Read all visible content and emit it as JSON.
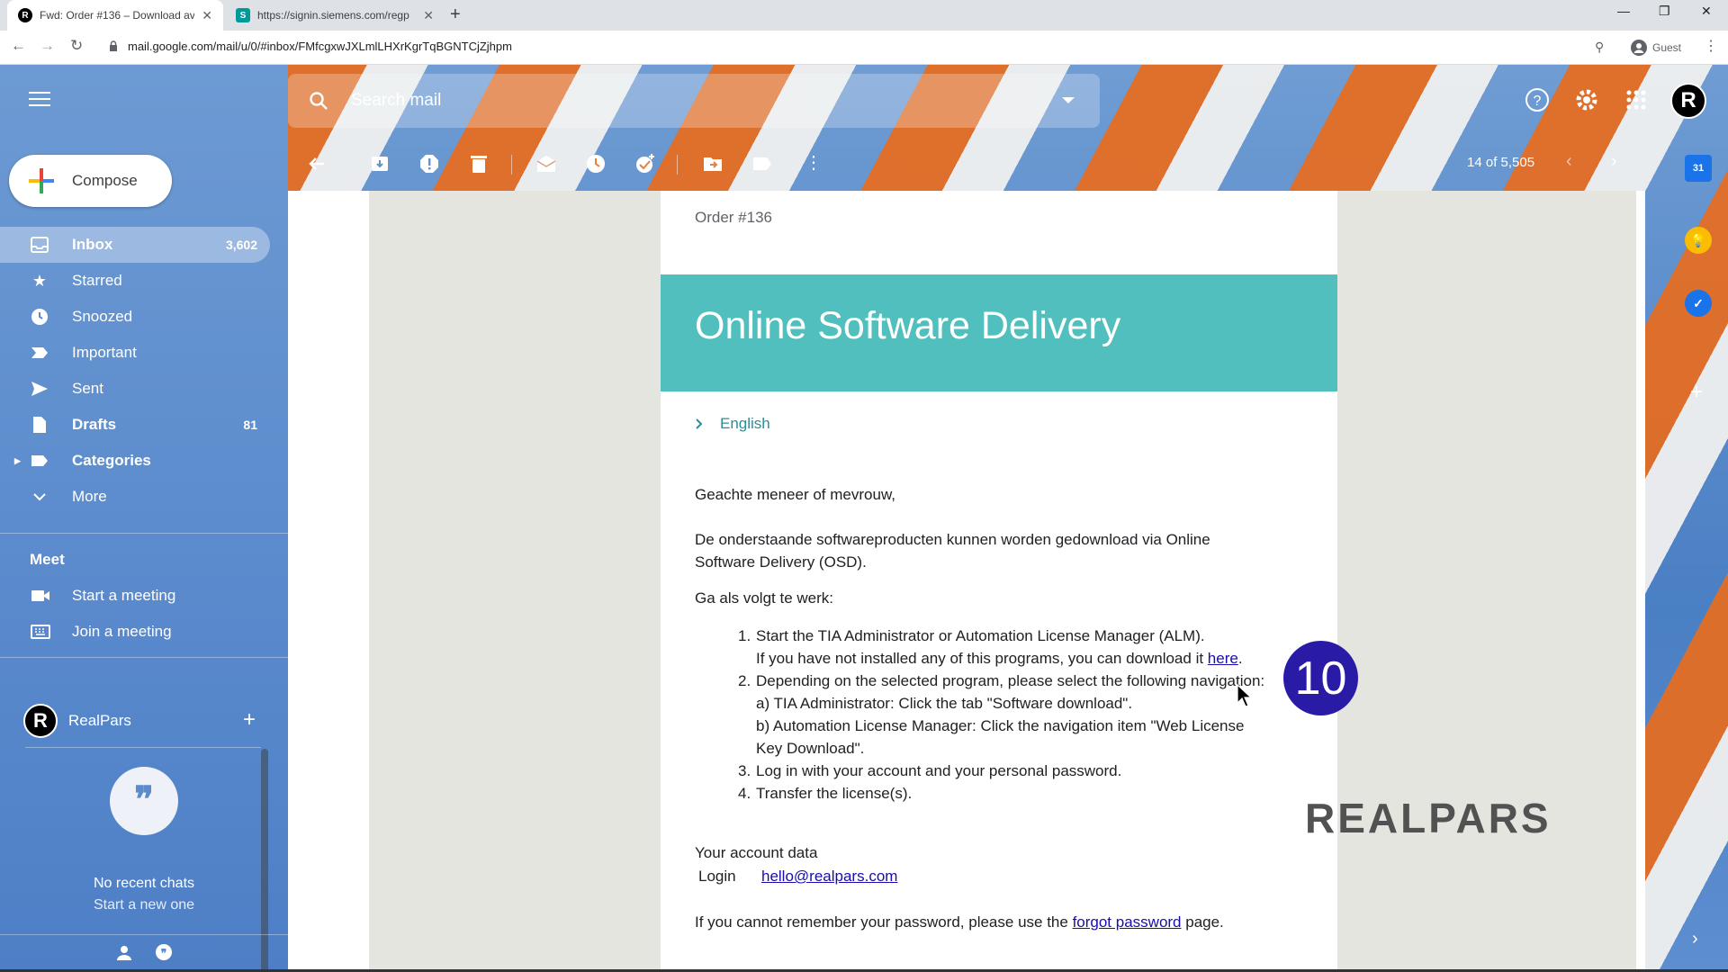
{
  "browser": {
    "tabs": [
      {
        "title": "Fwd: Order #136 – Download av",
        "favicon": "R",
        "active": true
      },
      {
        "title": "https://signin.siemens.com/regp",
        "favicon": "S",
        "active": false
      }
    ],
    "url": "mail.google.com/mail/u/0/#inbox/FMfcgxwJXLmlLHXrKgrTqBGNTCjZjhpm",
    "profile": "Guest"
  },
  "gmail": {
    "search_placeholder": "Search mail",
    "avatar_letter": "R",
    "compose_label": "Compose",
    "nav": [
      {
        "label": "Inbox",
        "count": "3,602",
        "icon": "inbox-icon"
      },
      {
        "label": "Starred",
        "count": "",
        "icon": "star-icon"
      },
      {
        "label": "Snoozed",
        "count": "",
        "icon": "clock-icon"
      },
      {
        "label": "Important",
        "count": "",
        "icon": "important-icon"
      },
      {
        "label": "Sent",
        "count": "",
        "icon": "send-icon"
      },
      {
        "label": "Drafts",
        "count": "81",
        "icon": "draft-icon"
      },
      {
        "label": "Categories",
        "count": "",
        "icon": "label-icon"
      },
      {
        "label": "More",
        "count": "",
        "icon": "chevron-down-icon"
      }
    ],
    "meet": {
      "title": "Meet",
      "start": "Start a meeting",
      "join": "Join a meeting"
    },
    "hangouts": {
      "user": "RealPars",
      "avatar_letter": "R",
      "empty_title": "No recent chats",
      "empty_sub": "Start a new one"
    },
    "pagination": "14 of 5,505"
  },
  "email": {
    "order": "Order #136",
    "banner_title": "Online Software Delivery",
    "language": "English",
    "greeting": "Geachte meneer of mevrouw,",
    "intro_line1": "De onderstaande softwareproducten kunnen worden gedownload via Online",
    "intro_line2": "Software Delivery (OSD).",
    "instructions": "Ga als volgt te werk:",
    "steps": {
      "s1_num": "1.",
      "s1_line1": "Start the TIA Administrator or Automation License Manager (ALM).",
      "s1_line2_pre": "If you have not installed any of this programs, you can download it ",
      "s1_link": "here",
      "s1_line2_post": ".",
      "s2_num": "2.",
      "s2_line1": "Depending on the selected program, please select the following navigation:",
      "s2_a": "a) TIA Administrator: Click the tab \"Software download\".",
      "s2_b1": "b) Automation License Manager: Click the navigation item \"Web License",
      "s2_b2": "Key Download\".",
      "s3_num": "3.",
      "s3": "Log in with your account and your personal password.",
      "s4_num": "4.",
      "s4": "Transfer the license(s)."
    },
    "account_title": "Your account data",
    "login_label": "Login",
    "login_value": "hello@realpars.com",
    "forgot_pre": "If you cannot remember your password, please use the ",
    "forgot_link": "forgot password",
    "forgot_post": " page."
  },
  "overlay": {
    "step_badge": "10",
    "watermark": "REALPARS"
  },
  "colors": {
    "banner": "#50bfbd",
    "badge": "#2a1ba6",
    "link": "#1a0dab"
  }
}
